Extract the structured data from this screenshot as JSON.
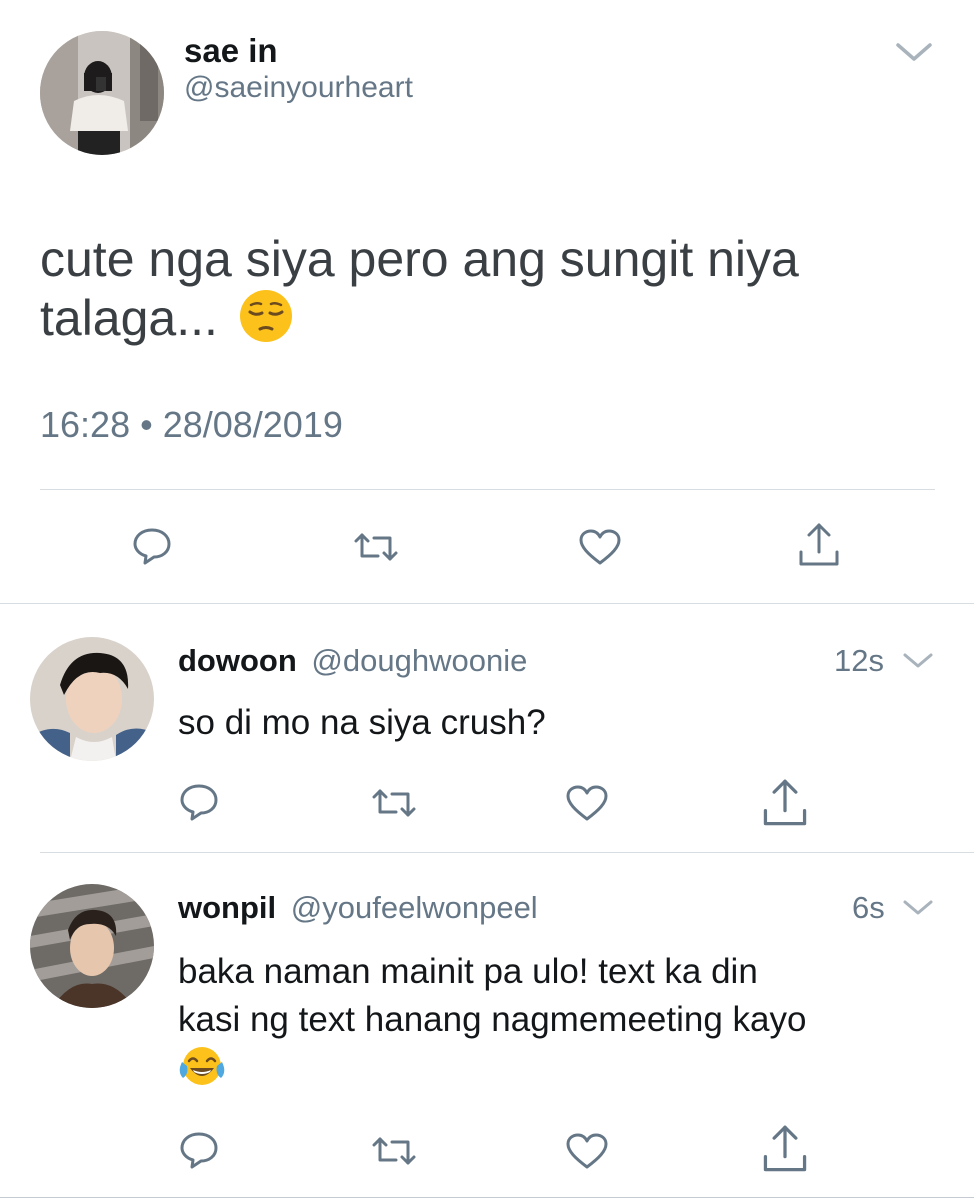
{
  "main_tweet": {
    "display_name": "sae in",
    "handle": "@saeinyourheart",
    "text": "cute nga siya pero ang sungit niya",
    "text_line2": "talaga...",
    "emoji": "pensive-face",
    "timestamp": "16:28 • 28/08/2019",
    "menu_icon": "chevron-down-icon",
    "actions": [
      "reply-icon",
      "retweet-icon",
      "like-icon",
      "share-icon"
    ]
  },
  "replies": [
    {
      "display_name": "dowoon",
      "handle": "@doughwoonie",
      "time": "12s",
      "text": "so di mo na siya crush?",
      "actions": [
        "reply-icon",
        "retweet-icon",
        "like-icon",
        "share-icon"
      ]
    },
    {
      "display_name": "wonpil",
      "handle": "@youfeelwonpeel",
      "time": "6s",
      "text_line1": "baka naman mainit pa ulo! text ka din",
      "text_line2": "kasi ng text hanang nagmemeeting kayo",
      "emoji": "face-with-tears-of-joy",
      "actions": [
        "reply-icon",
        "retweet-icon",
        "like-icon",
        "share-icon"
      ]
    }
  ],
  "colors": {
    "text": "#14171a",
    "muted": "#657786",
    "icon": "#657786",
    "divider": "#d8dde1",
    "emoji_yellow": "#fcc21b"
  }
}
